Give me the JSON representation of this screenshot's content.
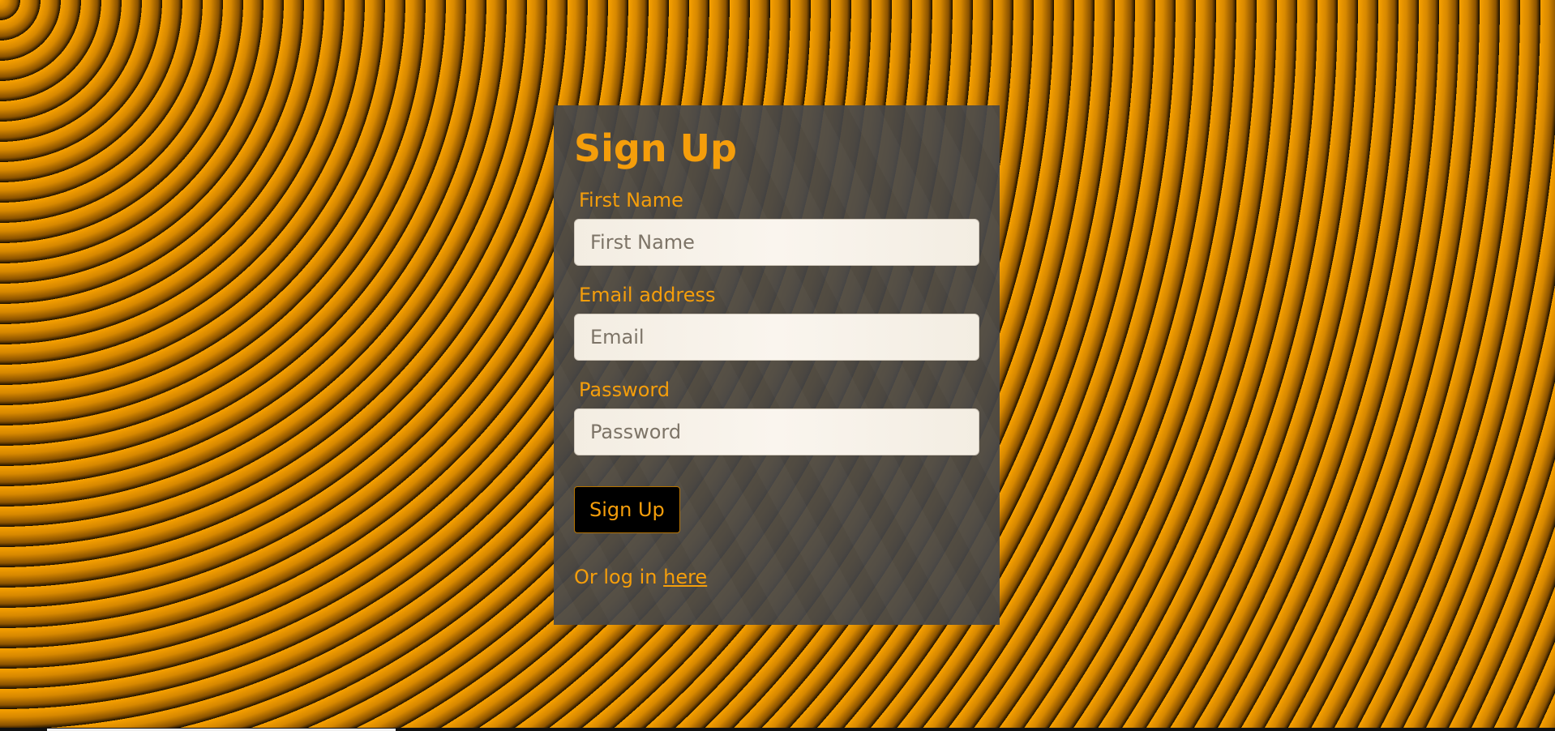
{
  "theme": {
    "accent_color": "#f59e0b",
    "card_color": "#474747",
    "button_color": "#000000"
  },
  "form": {
    "title": "Sign Up",
    "fields": [
      {
        "label": "First Name",
        "placeholder": "First Name",
        "value": ""
      },
      {
        "label": "Email address",
        "placeholder": "Email",
        "value": ""
      },
      {
        "label": "Password",
        "placeholder": "Password",
        "value": ""
      }
    ],
    "submit_label": "Sign Up",
    "login_prompt": "Or log in ",
    "login_link_text": "here"
  }
}
